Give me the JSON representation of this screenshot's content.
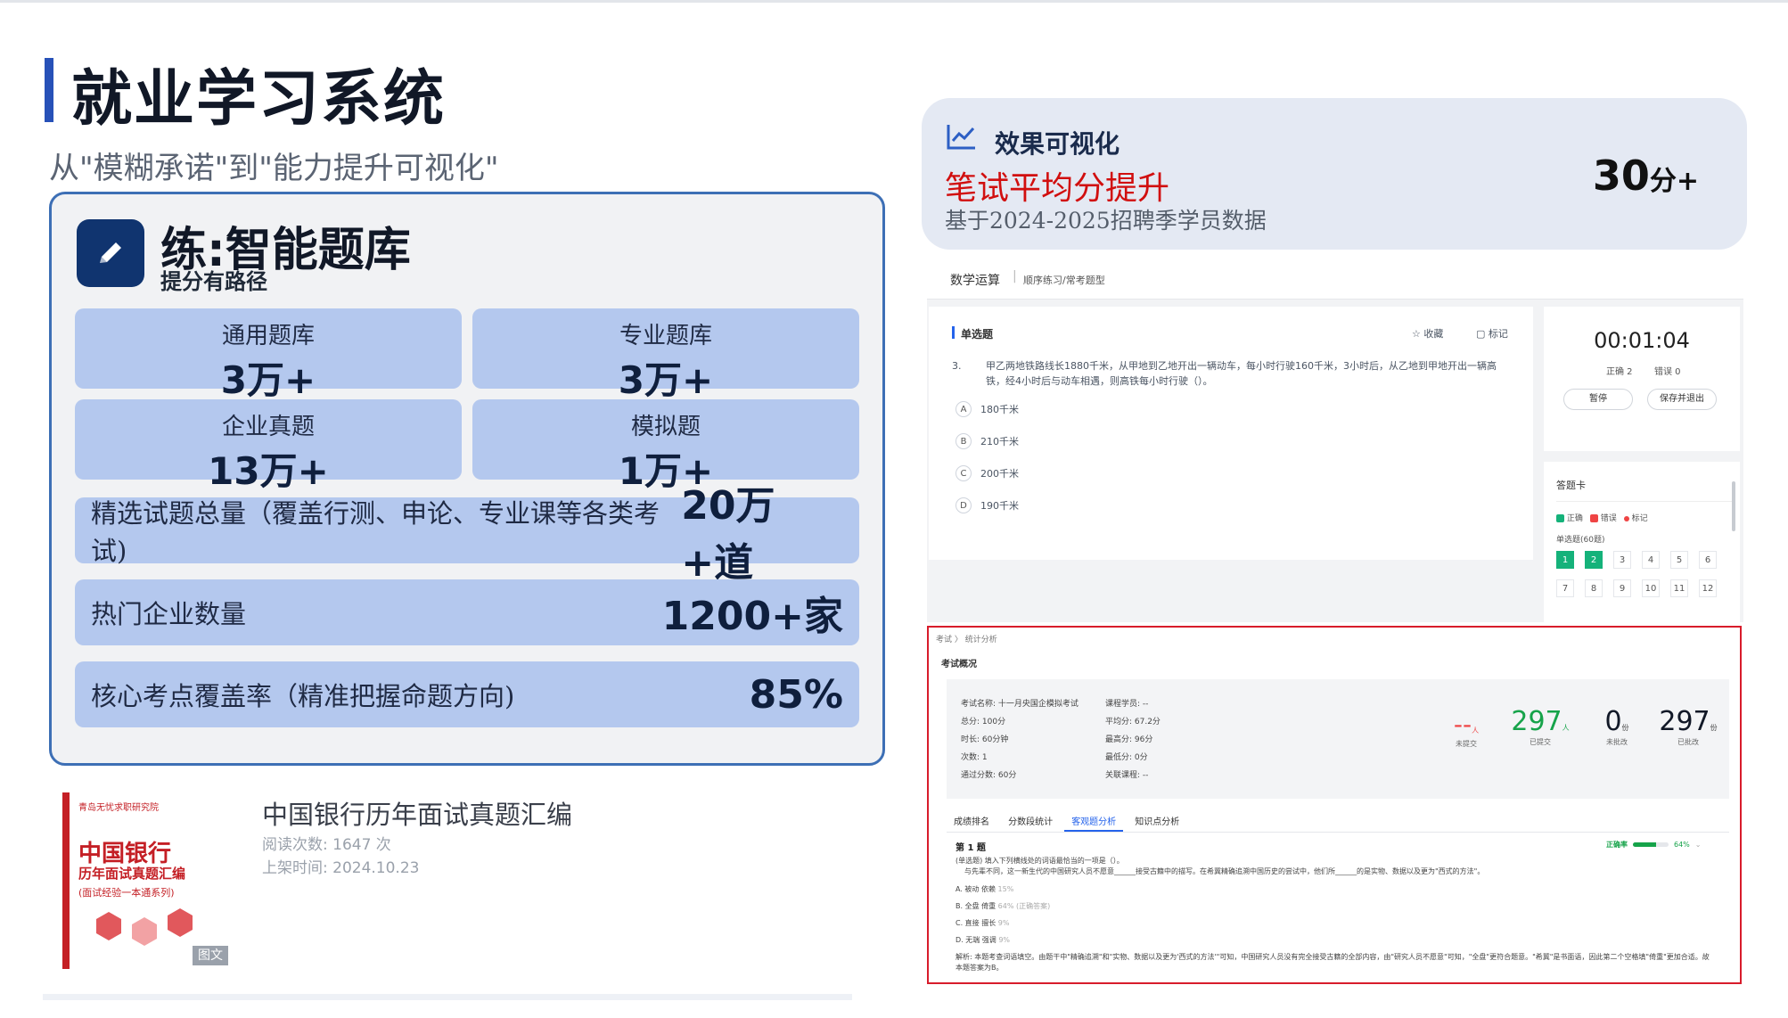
{
  "header": {
    "title": "就业学习系统",
    "subtitle": "从\"模糊承诺\"到\"能力提升可视化\""
  },
  "practice": {
    "title": "练:智能题库",
    "subtitle": "提分有路径",
    "tiles": [
      {
        "label": "通用题库",
        "value": "3万+"
      },
      {
        "label": "专业题库",
        "value": "3万+"
      },
      {
        "label": "企业真题",
        "value": "13万+"
      },
      {
        "label": "模拟题",
        "value": "1万+"
      }
    ],
    "rows": [
      {
        "label": "精选试题总量（覆盖行测、申论、专业课等各类考试)",
        "value": "20万+道"
      },
      {
        "label": "热门企业数量",
        "value": "1200+家"
      },
      {
        "label": "核心考点覆盖率（精准把握命题方向)",
        "value": "85%"
      }
    ]
  },
  "book": {
    "cover_top": "青岛无忧求职研究院",
    "cover_bank": "中国银行",
    "cover_line1": "历年面试真题汇编",
    "cover_line2": "(面试经验一本通系列)",
    "cover_tag": "图文",
    "title": "中国银行历年面试真题汇编",
    "reads": "阅读次数: 1647 次",
    "date": "上架时间: 2024.10.23"
  },
  "effect": {
    "title": "效果可视化",
    "headline": "笔试平均分提升",
    "note": "基于2024-2025招聘季学员数据",
    "value": "30",
    "unit": "分+"
  },
  "quiz": {
    "crumb_main": "数学运算",
    "crumb_sub": "顺序练习/常考题型",
    "type": "单选题",
    "favorite": "收藏",
    "mark": "标记",
    "qnum": "3.",
    "question": "甲乙两地铁路线长1880千米，从甲地到乙地开出一辆动车，每小时行驶160千米，3小时后，从乙地到甲地开出一辆高铁，经4小时后与动车相遇，则高铁每小时行驶（）。",
    "options": [
      {
        "key": "A",
        "text": "180千米"
      },
      {
        "key": "B",
        "text": "210千米"
      },
      {
        "key": "C",
        "text": "200千米"
      },
      {
        "key": "D",
        "text": "190千米"
      }
    ],
    "timer": "00:01:04",
    "correct": "正确 2",
    "wrong": "错误 0",
    "pause": "暂停",
    "save_exit": "保存并退出",
    "card_title": "答题卡",
    "legend": [
      "正确",
      "错误",
      "标记"
    ],
    "section": "单选题(60题)",
    "numbers": [
      "1",
      "2",
      "3",
      "4",
      "5",
      "6",
      "7",
      "8",
      "9",
      "10",
      "11",
      "12"
    ]
  },
  "stats": {
    "crumb": "考试 〉 统计分析",
    "heading": "考试概况",
    "info_left": [
      "考试名称: 十一月央国企模拟考试",
      "总分: 100分",
      "时长: 60分钟",
      "次数: 1",
      "通过分数: 60分"
    ],
    "info_right": [
      "课程学员: --",
      "平均分: 67.2分",
      "最高分: 96分",
      "最低分: 0分",
      "关联课程: --"
    ],
    "metrics": [
      {
        "value": "--",
        "unit": "人",
        "label": "未提交",
        "color": "#ef4444"
      },
      {
        "value": "297",
        "unit": "人",
        "label": "已提交",
        "color": "#16a34a"
      },
      {
        "value": "0",
        "unit": "份",
        "label": "未批改",
        "color": "#111827"
      },
      {
        "value": "297",
        "unit": "份",
        "label": "已批改",
        "color": "#111827"
      }
    ],
    "tabs": [
      "成绩排名",
      "分数段统计",
      "客观题分析",
      "知识点分析"
    ],
    "q_title": "第 1 题",
    "rate_label": "正确率",
    "rate_value": "64%",
    "rate": 0.64,
    "q_text1": "(单选题) 填入下列横线处的词语最恰当的一项是（）。",
    "q_text2": "与先辈不同，这一新生代的中国研究人员不愿意______接受古籍中的描写。在希冀精确追溯中国历史的尝试中，他们所______的是实物、数据以及更为\"西式的方法\"。",
    "answers": [
      {
        "text": "A. 被动 依赖",
        "pct": "15%"
      },
      {
        "text": "B. 全盘 倚重",
        "pct": "64% (正确答案)"
      },
      {
        "text": "C. 直接 擅长",
        "pct": "9%"
      },
      {
        "text": "D. 无端 强调",
        "pct": "9%"
      }
    ],
    "analysis": "解析:  本题考查词语填空。由题干中\"精确追溯\"和\"实物、数据以及更为'西式的方法'\"可知，中国研究人员没有完全接受古籍的全部内容，由\"研究人员不愿意\"可知，\"全盘\"更符合题意。\"希冀\"是书面语，因此第二个空格填\"倚重\"更加合适。故本题答案为B。"
  }
}
